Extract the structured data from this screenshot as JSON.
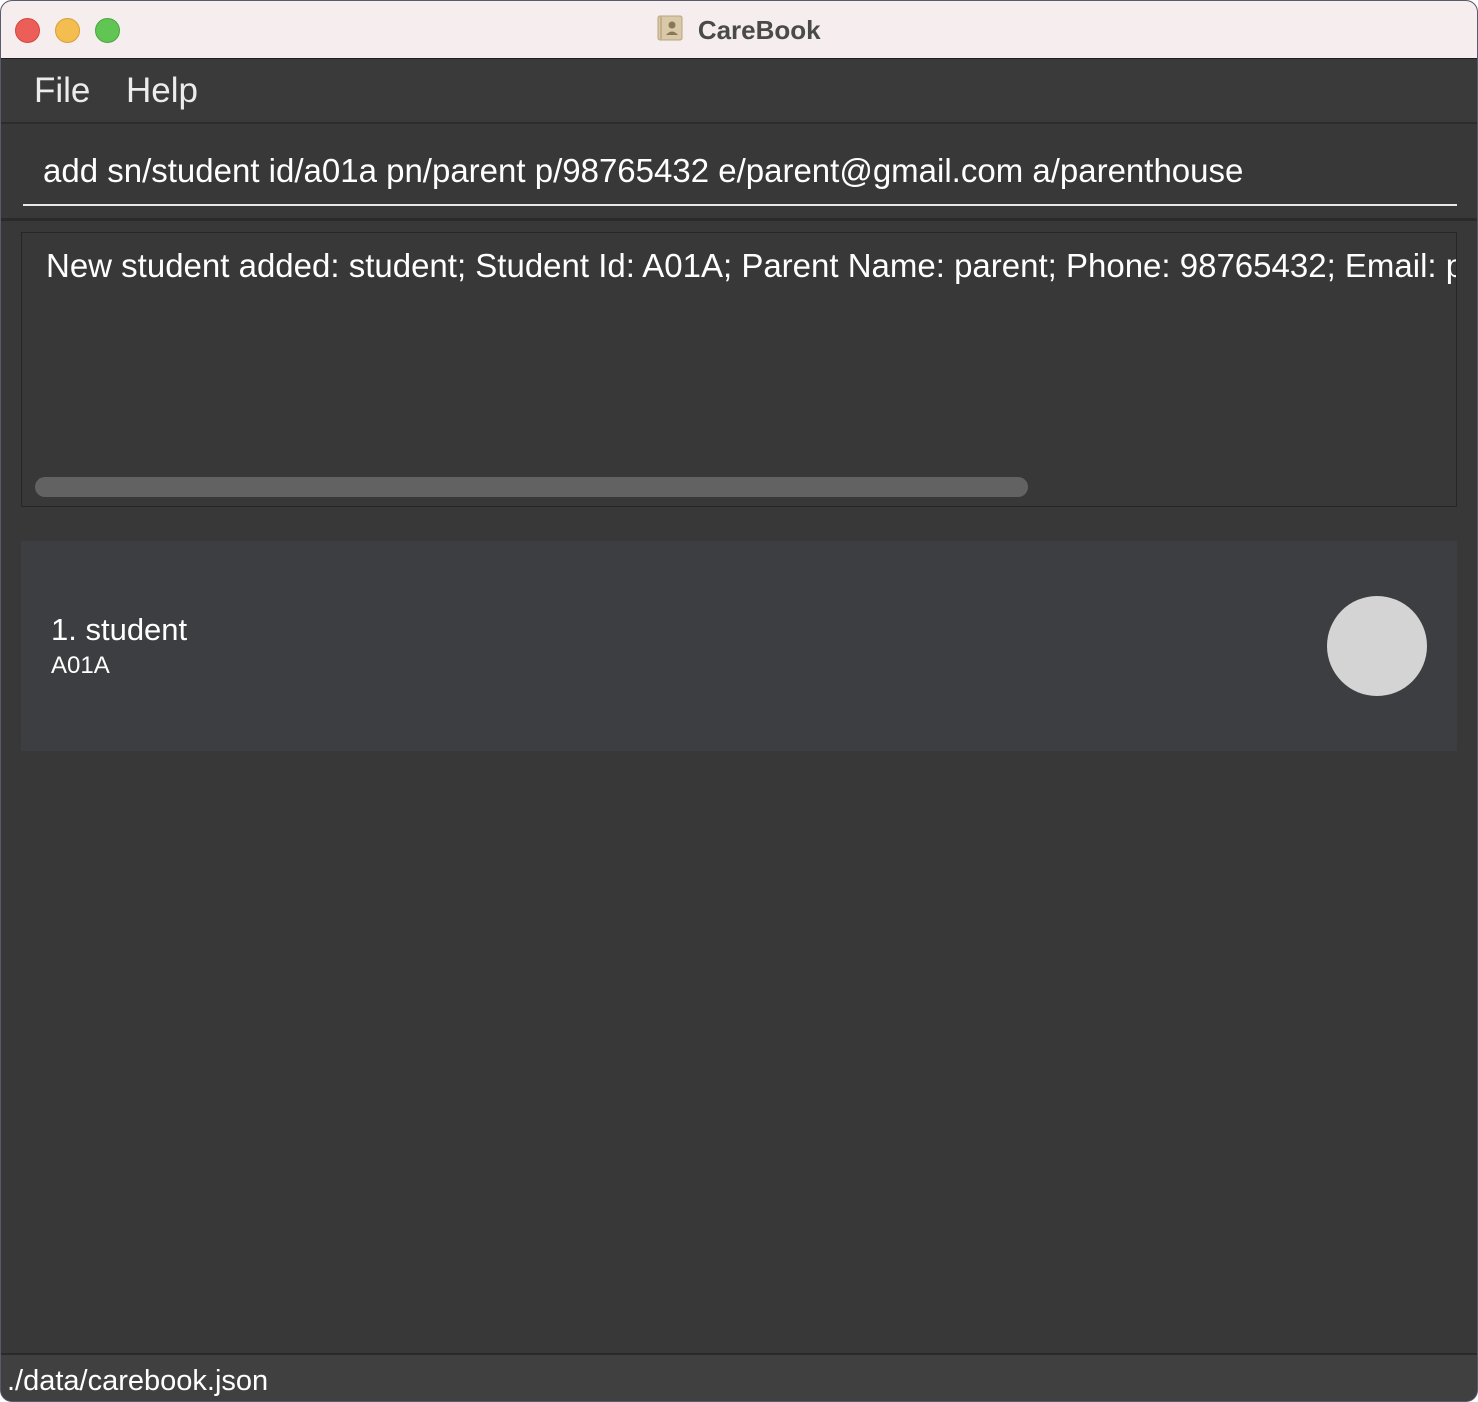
{
  "window": {
    "title": "CareBook"
  },
  "menu": {
    "items": [
      "File",
      "Help"
    ]
  },
  "command_box": {
    "value": "add sn/student id/a01a pn/parent p/98765432 e/parent@gmail.com a/parenthouse"
  },
  "result_display": {
    "text": "New student added: student; Student Id: A01A; Parent Name: parent; Phone: 98765432; Email: parent@gmail.com; Address: parenthouse"
  },
  "student_list": [
    {
      "index_name": "1. student",
      "student_id": "A01A"
    }
  ],
  "status_bar": {
    "file_path": "./data/carebook.json"
  },
  "colors": {
    "background": "#383838",
    "card": "#3d3e41",
    "titlebar": "#f6eeee",
    "close": "#ec5f58",
    "minimize": "#f4bd4f",
    "maximize": "#61c554",
    "avatar": "#d4d4d4"
  }
}
